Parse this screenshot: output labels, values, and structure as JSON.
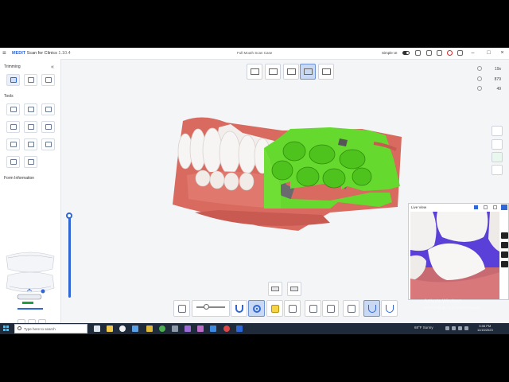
{
  "app": {
    "brand": "MEDIT",
    "name": " Scan for Clinics",
    "version": " 1.10.4",
    "document_title": "Full Mouth Scan Case",
    "simple_ui_label": "Simple UI"
  },
  "left_panel": {
    "trimming_label": "Trimming",
    "tools_label": "Tools",
    "form_information_label": "Form Information"
  },
  "stats": {
    "time": "19s",
    "count1": "879",
    "count2": "49"
  },
  "live_view": {
    "title": "Live View",
    "watermark": "Activate Windows",
    "watermark_sub": "Go to Settings to activate Windows."
  },
  "taskbar": {
    "search_placeholder": "Type here to search",
    "weather": "68°F Sunny",
    "time": "5:06 PM",
    "date": "11/15/2023"
  },
  "colors": {
    "accent": "#2f67d6",
    "scan_green": "#62d62a",
    "gum": "#d86a60"
  }
}
